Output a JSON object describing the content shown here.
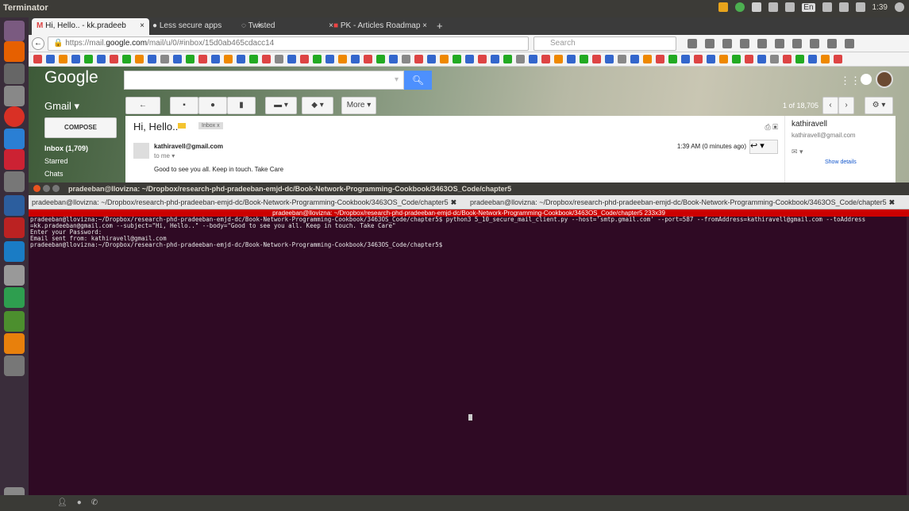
{
  "topbar": {
    "title": "Terminator",
    "lang": "En",
    "time": "1:39"
  },
  "browser": {
    "tabs": [
      {
        "label": "Hi, Hello.. - kk.pradeeb"
      },
      {
        "label": "Less secure apps"
      },
      {
        "label": "Twisted"
      },
      {
        "label": "PK - Articles Roadmap"
      }
    ],
    "newtab_label": "+",
    "url_prefix": "https://mail.",
    "url_host": "google.com",
    "url_suffix": "/mail/u/0/#inbox/15d0ab465cdacc14",
    "search_placeholder": "Search",
    "back_label": "←"
  },
  "gmail": {
    "logo": "Google",
    "gmail_label": "Gmail ▾",
    "compose": "COMPOSE",
    "inbox": "Inbox (1,709)",
    "starred": "Starred",
    "chats": "Chats",
    "more_btn": "More ▾",
    "pager": "1 of 18,705",
    "subject": "Hi, Hello..",
    "inbox_chip": "Inbox  x",
    "sender": "kathiravell@gmail.com",
    "to_me": "to me  ▾",
    "body": "Good to see you all. Keep in touch. Take Care",
    "time": "1:39 AM (0 minutes ago)",
    "side_name": "kathiravell",
    "side_email": "kathiravell@gmail.com",
    "side_mail_icon": "✉ ▾",
    "show_details": "Show details"
  },
  "terminal": {
    "window_title": "pradeeban@llovizna: ~/Dropbox/research-phd-pradeeban-emjd-dc/Book-Network-Programming-Cookbook/3463OS_Code/chapter5",
    "tab1": "pradeeban@llovizna: ~/Dropbox/research-phd-pradeeban-emjd-dc/Book-Network-Programming-Cookbook/3463OS_Code/chapter5",
    "tab2": "pradeeban@llovizna: ~/Dropbox/research-phd-pradeeban-emjd-dc/Book-Network-Programming-Cookbook/3463OS_Code/chapter5",
    "tab_close": "✖",
    "active_bar": "pradeeban@llovizna: ~/Dropbox/research-phd-pradeeban-emjd-dc/Book-Network-Programming-Cookbook/3463OS_Code/chapter5 233x39",
    "lines": [
      "pradeeban@llovizna:~/Dropbox/research-phd-pradeeban-emjd-dc/Book-Network-Programming-Cookbook/3463OS_Code/chapter5$ python3 5_10_secure_mail_client.py --host='smtp.gmail.com' --port=587 --fromAddress=kathiravell@gmail.com --toAddress",
      "=kk.pradeeban@gmail.com --subject=\"Hi, Hello..\" --body=\"Good to see you all. Keep in touch. Take Care\"",
      "Enter your Password:",
      "Email sent from: kathiravell@gmail.com",
      "pradeeban@llovizna:~/Dropbox/research-phd-pradeeban-emjd-dc/Book-Network-Programming-Cookbook/3463OS_Code/chapter5$"
    ]
  }
}
